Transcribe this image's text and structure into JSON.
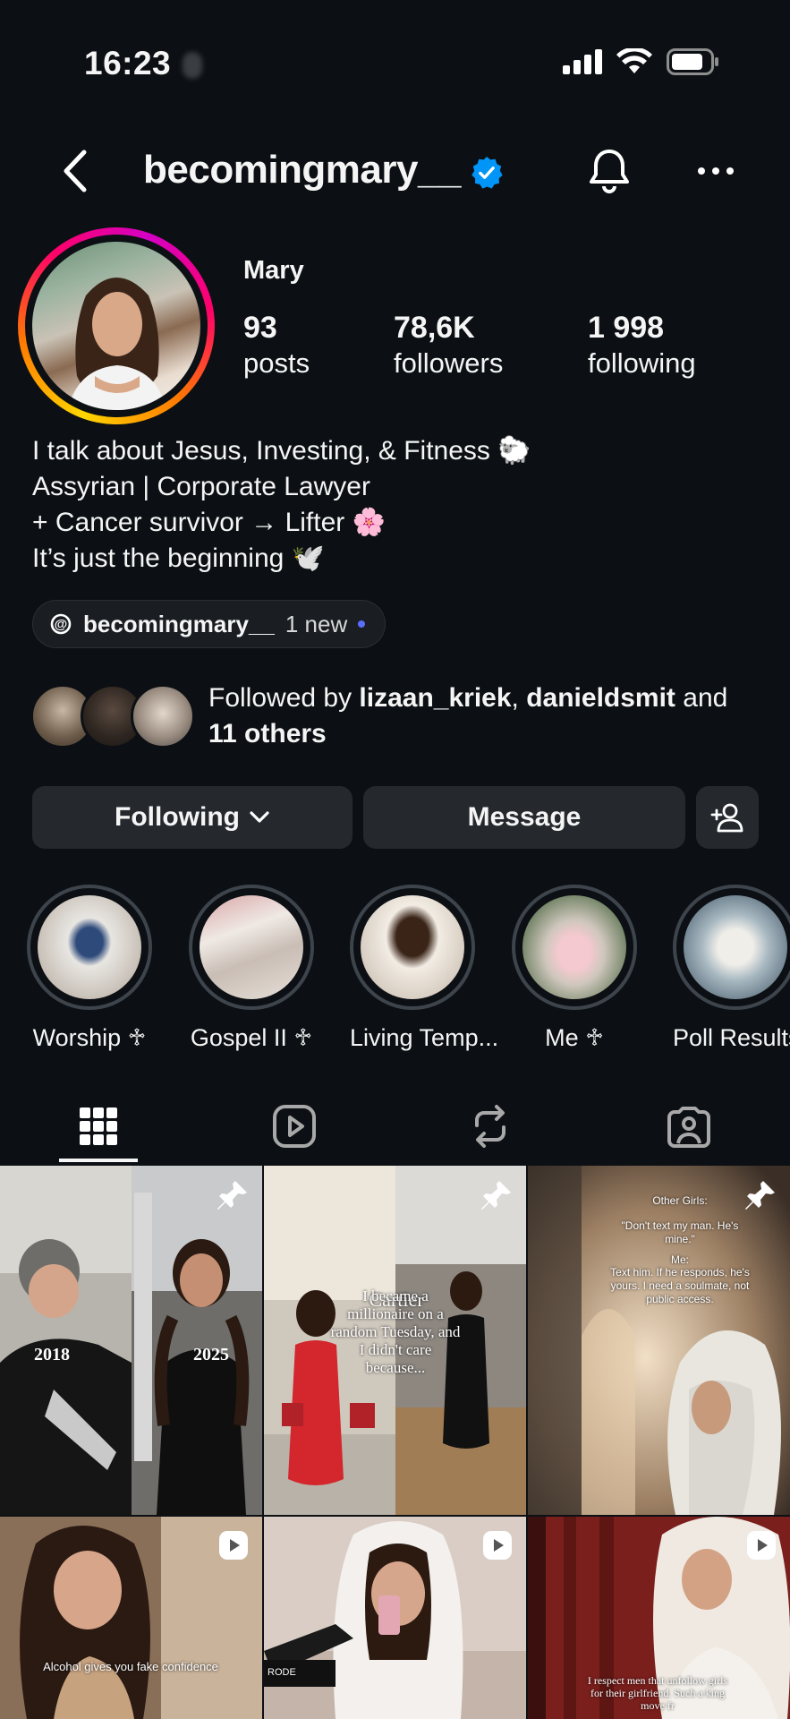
{
  "status": {
    "time": "16:23"
  },
  "header": {
    "username": "becomingmary__"
  },
  "profile": {
    "name": "Mary",
    "stats": [
      {
        "num": "93",
        "label": "posts"
      },
      {
        "num": "78,6K",
        "label": "followers"
      },
      {
        "num": "1 998",
        "label": "following"
      }
    ],
    "bio": [
      "I talk about Jesus, Investing, & Fitness 🐑",
      "Assyrian | Corporate Lawyer",
      "+ Cancer survivor → Lifter 🌸",
      "It’s just the beginning 🕊️"
    ],
    "threads": {
      "handle": "becomingmary__",
      "new_label": "1 new"
    },
    "followed_by": {
      "prefix": "Followed by ",
      "user1": "lizaan_kriek",
      "sep": ", ",
      "user2": "danieldsmit",
      "and": " and",
      "others": "11 others"
    }
  },
  "actions": {
    "following_label": "Following",
    "message_label": "Message"
  },
  "highlights": [
    {
      "label": "Worship ♱"
    },
    {
      "label": "Gospel II ♱"
    },
    {
      "label": "Living Temp..."
    },
    {
      "label": "Me ♱"
    },
    {
      "label": "Poll Results"
    }
  ],
  "posts": {
    "p1": {
      "left_year": "2018",
      "right_year": "2025"
    },
    "p2": {
      "brand": "Cartier",
      "overlay": "I became a millionaire on a random Tuesday, and I didn't care because..."
    },
    "p3": {
      "title": "Other Girls:",
      "line1": "\"Don't text my man. He's mine.\"",
      "line2": "Me:",
      "line3": "Text him. If he responds, he's yours. I need a soulmate, not public access."
    },
    "p4": {
      "caption": "Alcohol gives you fake confidence"
    },
    "p5": {
      "mic_label": "RODE"
    },
    "p6": {
      "caption": "I respect men that unfollow girls for their girlfriend. Such a king move fr"
    }
  },
  "colors": {
    "background": "#0c1014",
    "button": "#25292e",
    "verified": "#0095f6"
  }
}
